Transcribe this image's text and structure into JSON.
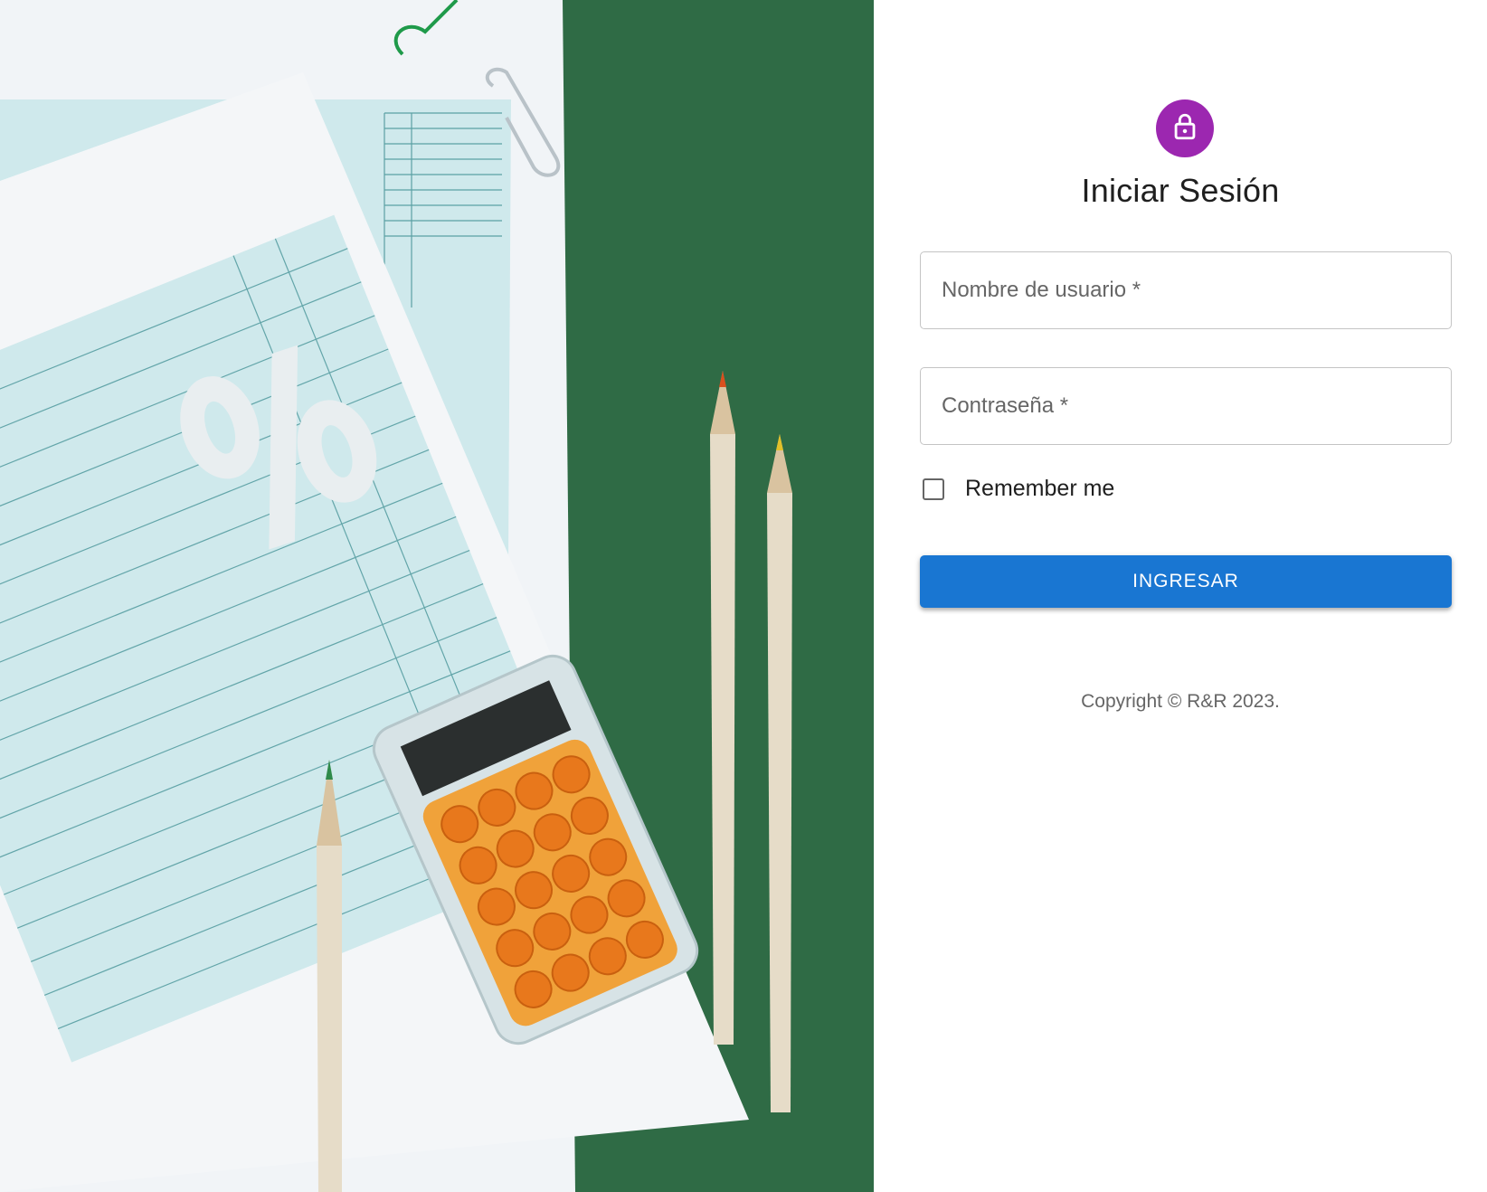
{
  "login": {
    "title": "Iniciar Sesión",
    "username_label": "Nombre de usuario *",
    "password_label": "Contraseña *",
    "remember_label": "Remember me",
    "remember_checked": false,
    "submit_label": "INGRESAR",
    "copyright": "Copyright © R&R 2023."
  },
  "colors": {
    "avatar": "#9c27b0",
    "primary": "#1976d2",
    "hero_background": "#2f6b45"
  },
  "icons": {
    "avatar_icon": "lock-outline-icon"
  }
}
